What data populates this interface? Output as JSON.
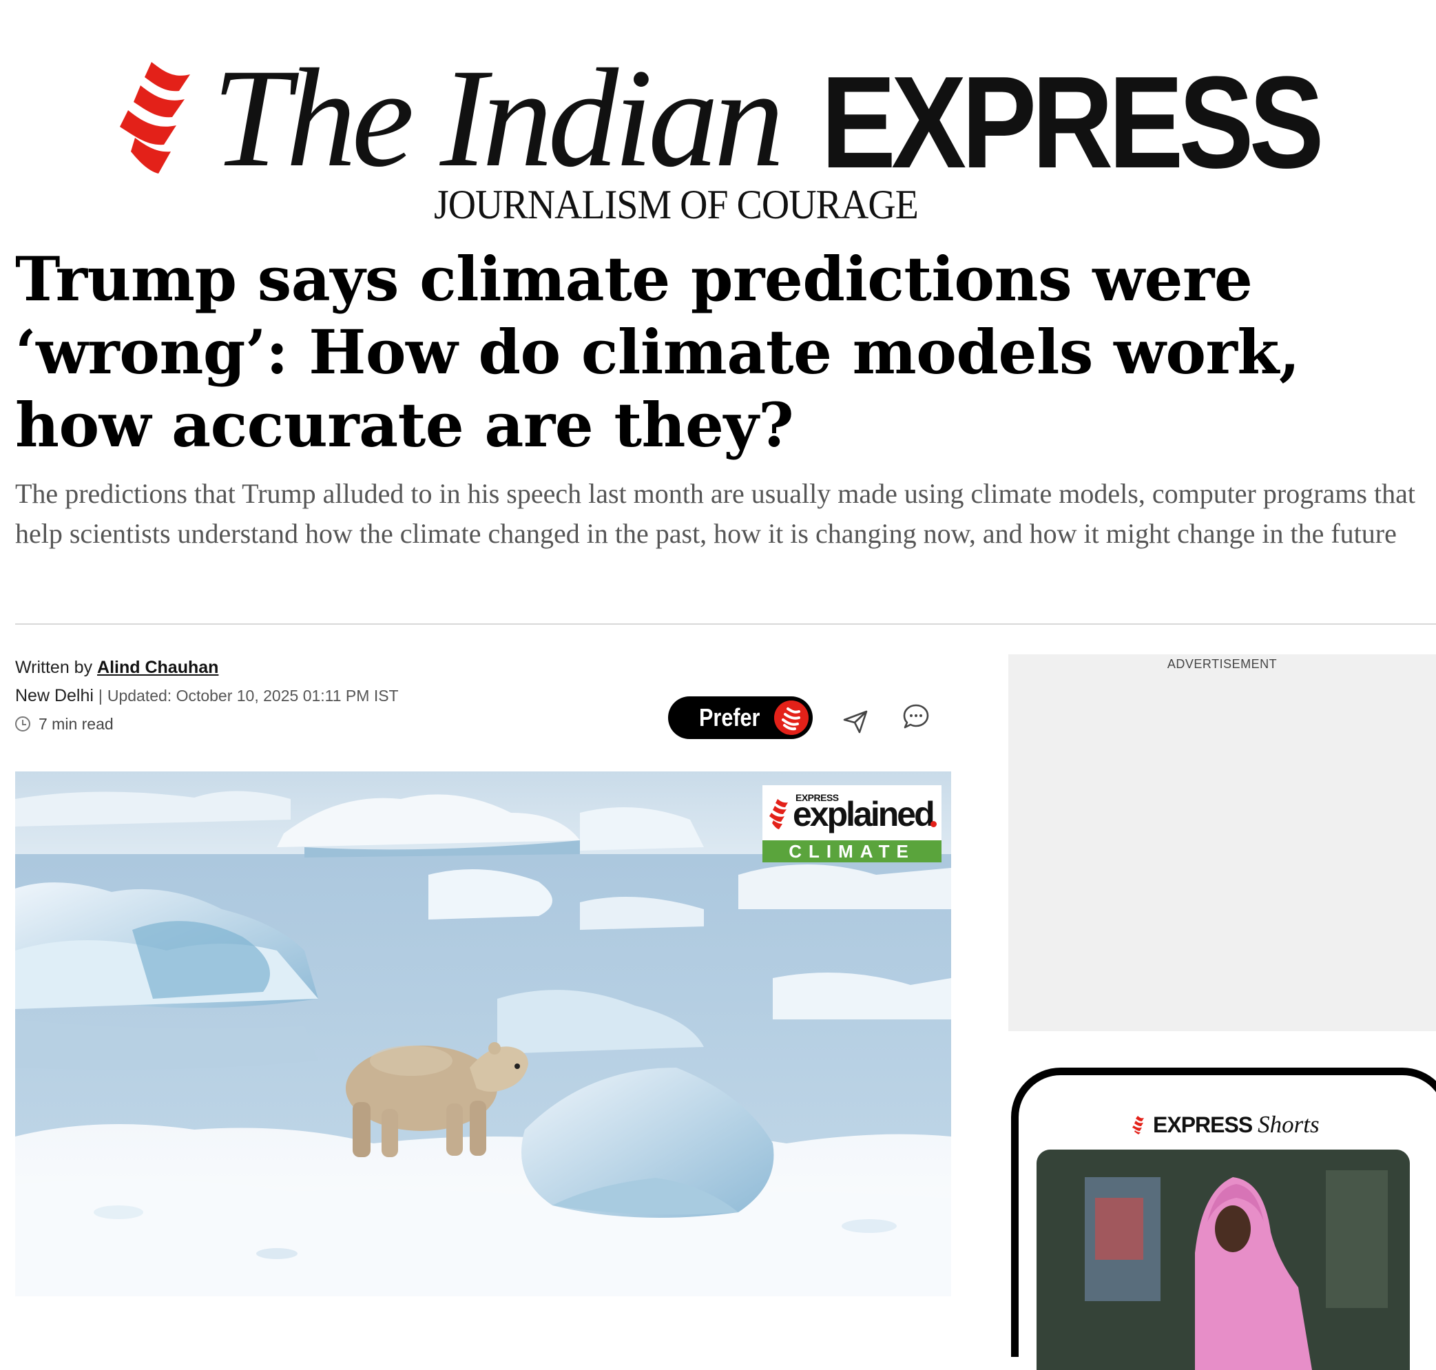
{
  "brand": {
    "name_part1": "The Indian",
    "name_part2": "EXPRESS",
    "tagline": "JOURNALISM OF COURAGE",
    "accent_color": "#e32119"
  },
  "article": {
    "headline": "Trump says climate predictions were ‘wrong’: How do climate models work, how accurate are they?",
    "standfirst": "The predictions that Trump alluded to in his speech last month are usually made using climate models, computer programs that help scientists understand how the climate changed in the past, how it is changing now, and how it might change in the future",
    "byline_prefix": "Written by",
    "author": "Alind Chauhan",
    "location": "New Delhi",
    "separator": "|",
    "updated": "Updated: October 10, 2025 01:11 PM IST",
    "read_time": "7 min read"
  },
  "actions": {
    "prefer_label": "Prefer",
    "share_icon": "send-icon",
    "comment_icon": "comment-icon"
  },
  "hero_badge": {
    "small": "EXPRESS",
    "main": "explained",
    "category": "CLIMATE",
    "category_color": "#5aa43c"
  },
  "sidebar": {
    "ad_label": "ADVERTISEMENT",
    "shorts_brand": "EXPRESS",
    "shorts_label": "Shorts"
  }
}
